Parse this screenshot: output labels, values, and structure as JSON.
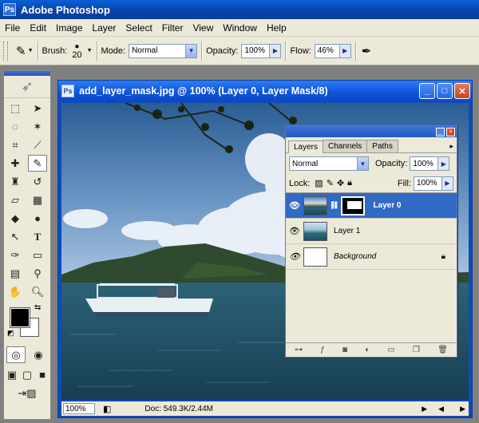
{
  "app": {
    "title": "Adobe Photoshop"
  },
  "menu": [
    "File",
    "Edit",
    "Image",
    "Layer",
    "Select",
    "Filter",
    "View",
    "Window",
    "Help"
  ],
  "options": {
    "brush_label": "Brush:",
    "brush_size": "20",
    "mode_label": "Mode:",
    "mode_value": "Normal",
    "opacity_label": "Opacity:",
    "opacity_value": "100%",
    "flow_label": "Flow:",
    "flow_value": "46%"
  },
  "document": {
    "title": "add_layer_mask.jpg @ 100% (Layer 0, Layer Mask/8)",
    "zoom": "100%",
    "doc_info": "Doc: 549.3K/2.44M"
  },
  "layers_panel": {
    "tabs": [
      "Layers",
      "Channels",
      "Paths"
    ],
    "blend_mode": "Normal",
    "opacity_label": "Opacity:",
    "opacity_value": "100%",
    "lock_label": "Lock:",
    "fill_label": "Fill:",
    "fill_value": "100%",
    "layers": [
      {
        "name": "Layer 0",
        "selected": true
      },
      {
        "name": "Layer 1",
        "selected": false
      },
      {
        "name": "Background",
        "selected": false
      }
    ]
  },
  "colors": {
    "title_blue": "#0b47c0",
    "selection": "#316ac5",
    "panel_bg": "#ece9d8"
  }
}
